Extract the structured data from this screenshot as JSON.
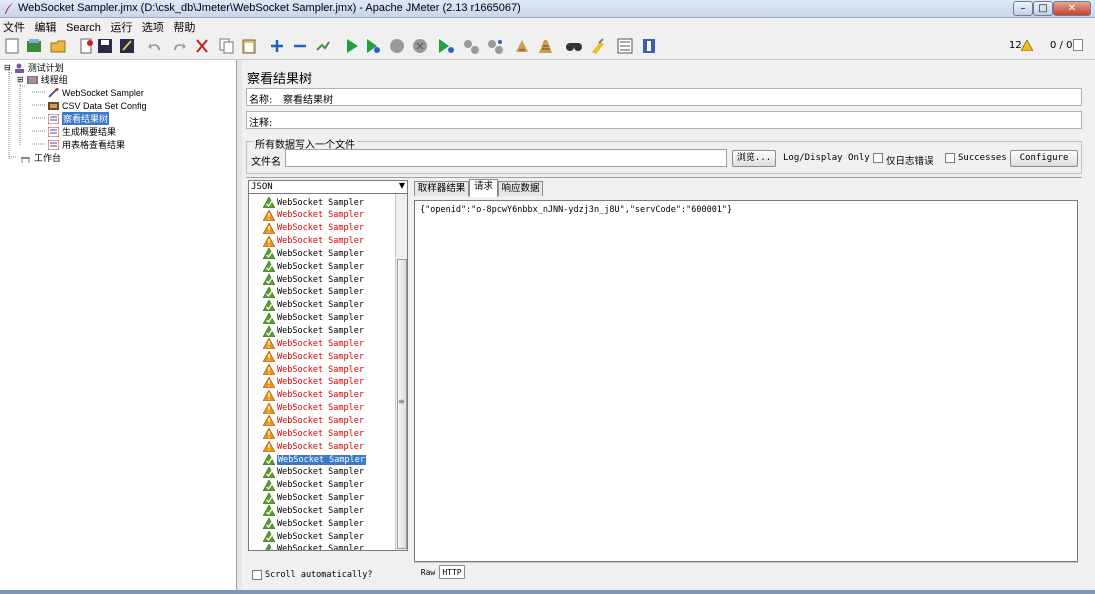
{
  "window": {
    "title": "WebSocket Sampler.jmx (D:\\csk_db\\Jmeter\\WebSocket Sampler.jmx) - Apache JMeter (2.13 r1665067)"
  },
  "menu": [
    "文件",
    "编辑",
    "Search",
    "运行",
    "选项",
    "帮助"
  ],
  "toolbar": {
    "warn_count": "12",
    "thread_status": "0 / 0"
  },
  "tree": {
    "items": [
      {
        "label": "测试计划",
        "icon": "test-plan-icon"
      },
      {
        "label": "线程组",
        "icon": "thread-group-icon"
      },
      {
        "label": "WebSocket Sampler",
        "icon": "sampler-icon"
      },
      {
        "label": "CSV Data Set Config",
        "icon": "config-icon"
      },
      {
        "label": "察看结果树",
        "icon": "listener-icon"
      },
      {
        "label": "生成概要结果",
        "icon": "listener-icon"
      },
      {
        "label": "用表格查看结果",
        "icon": "listener-icon"
      },
      {
        "label": "工作台",
        "icon": "workbench-icon"
      }
    ]
  },
  "panel": {
    "title": "察看结果树",
    "name_label": "名称:",
    "name_value": "察看结果树",
    "comment_label": "注释:",
    "file_section": "所有数据写入一个文件",
    "filename_label": "文件名",
    "browse": "浏览...",
    "log_display": "Log/Display Only",
    "errors_only": "仅日志错误",
    "successes": "Successes",
    "configure": "Configure"
  },
  "results": {
    "renderer": "JSON",
    "scroll_auto": "Scroll automatically?",
    "items": [
      {
        "label": "WebSocket Sampler",
        "status": "ok"
      },
      {
        "label": "WebSocket Sampler",
        "status": "err"
      },
      {
        "label": "WebSocket Sampler",
        "status": "err"
      },
      {
        "label": "WebSocket Sampler",
        "status": "err"
      },
      {
        "label": "WebSocket Sampler",
        "status": "ok"
      },
      {
        "label": "WebSocket Sampler",
        "status": "ok"
      },
      {
        "label": "WebSocket Sampler",
        "status": "ok"
      },
      {
        "label": "WebSocket Sampler",
        "status": "ok"
      },
      {
        "label": "WebSocket Sampler",
        "status": "ok"
      },
      {
        "label": "WebSocket Sampler",
        "status": "ok"
      },
      {
        "label": "WebSocket Sampler",
        "status": "ok"
      },
      {
        "label": "WebSocket Sampler",
        "status": "err"
      },
      {
        "label": "WebSocket Sampler",
        "status": "err"
      },
      {
        "label": "WebSocket Sampler",
        "status": "err"
      },
      {
        "label": "WebSocket Sampler",
        "status": "err"
      },
      {
        "label": "WebSocket Sampler",
        "status": "err"
      },
      {
        "label": "WebSocket Sampler",
        "status": "err"
      },
      {
        "label": "WebSocket Sampler",
        "status": "err"
      },
      {
        "label": "WebSocket Sampler",
        "status": "err"
      },
      {
        "label": "WebSocket Sampler",
        "status": "err"
      },
      {
        "label": "WebSocket Sampler",
        "status": "selected"
      },
      {
        "label": "WebSocket Sampler",
        "status": "ok"
      },
      {
        "label": "WebSocket Sampler",
        "status": "ok"
      },
      {
        "label": "WebSocket Sampler",
        "status": "ok"
      },
      {
        "label": "WebSocket Sampler",
        "status": "ok"
      },
      {
        "label": "WebSocket Sampler",
        "status": "ok"
      },
      {
        "label": "WebSocket Sampler",
        "status": "ok"
      },
      {
        "label": "WebSocket Sampler",
        "status": "ok"
      },
      {
        "label": "WebSocket Sampler",
        "status": "ok"
      }
    ]
  },
  "tabs": [
    "取样器结果",
    "请求",
    "响应数据"
  ],
  "request_body": "{\"openid\":\"o-8pcwY6nbbx_nJNN-ydzj3n_j8U\",\"servCode\":\"600001\"}",
  "bottom_tabs": [
    "Raw",
    "HTTP"
  ],
  "colors": {
    "error": "#e00000",
    "selection": "#3a78c8"
  }
}
